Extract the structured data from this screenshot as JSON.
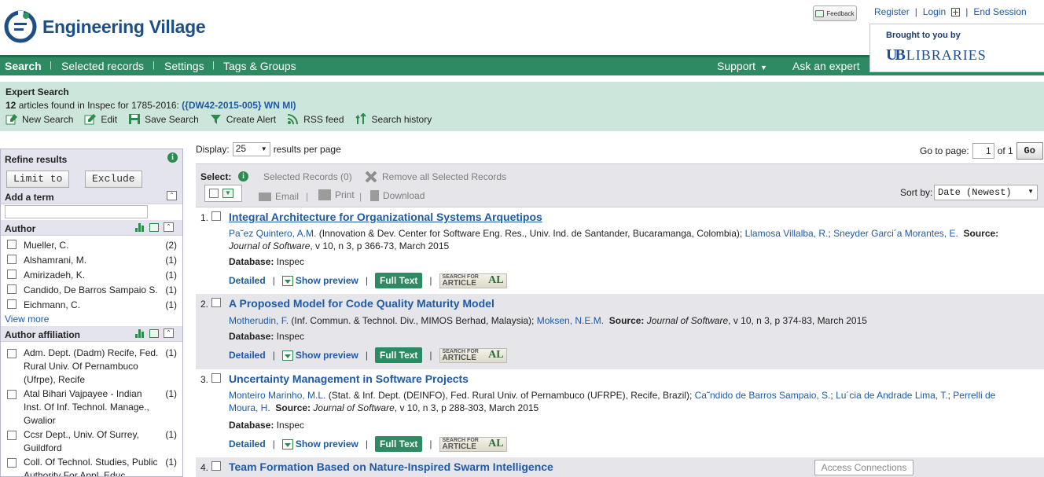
{
  "header": {
    "logo_text": "Engineering Village",
    "feedback_label": "Feedback",
    "links": [
      "Register",
      "Login",
      "End Session"
    ],
    "brought_label": "Brought to you by",
    "library_mark": "UB",
    "library_name": "LIBRARIES"
  },
  "nav": {
    "items": [
      "Search",
      "Selected records",
      "Settings",
      "Tags & Groups"
    ],
    "support": "Support",
    "ask": "Ask an expert"
  },
  "search": {
    "title": "Expert Search",
    "count": "12",
    "summary_text": " articles found in Inspec for 1785-2016: ",
    "query": "({DW42-2015-005} WN MI)",
    "actions": [
      "New Search",
      "Edit",
      "Save Search",
      "Create Alert",
      "RSS feed",
      "Search history"
    ]
  },
  "sidebar": {
    "refine_title": "Refine results",
    "limit_label": "Limit to",
    "exclude_label": "Exclude",
    "add_term": "Add a term",
    "author_title": "Author",
    "authors": [
      {
        "name": "Mueller, C.",
        "count": "(2)"
      },
      {
        "name": "Alshamrani, M.",
        "count": "(1)"
      },
      {
        "name": "Amirizadeh, K.",
        "count": "(1)"
      },
      {
        "name": "Candido, De Barros Sampaio S.",
        "count": "(1)"
      },
      {
        "name": "Eichmann, C.",
        "count": "(1)"
      }
    ],
    "view_more": "View more",
    "affiliation_title": "Author affiliation",
    "affiliations": [
      {
        "name": "Adm. Dept. (Dadm) Recife, Fed. Rural Univ. Of Pernambuco (Ufrpe), Recife",
        "count": "(1)"
      },
      {
        "name": "Atal Bihari Vajpayee - Indian Inst. Of Inf. Technol. Manage., Gwalior",
        "count": "(1)"
      },
      {
        "name": "Ccsr Dept., Univ. Of Surrey, Guildford",
        "count": "(1)"
      },
      {
        "name": "Coll. Of Technol. Studies, Public Authority For Appl. Educ.",
        "count": "(1)"
      }
    ]
  },
  "results_bar": {
    "display_label": "Display:",
    "per_page": "25",
    "per_page_suffix": "results per page",
    "goto_label": "Go to page:",
    "page_value": "1",
    "of_label": "of 1",
    "go_label": "Go"
  },
  "toolbar": {
    "select_label": "Select:",
    "selected_records": "Selected Records (0)",
    "remove_all": "Remove all Selected Records",
    "email": "Email",
    "print": "Print",
    "download": "Download",
    "sort_label": "Sort by:",
    "sort_value": "Date (Newest)"
  },
  "result_common": {
    "database_label": "Database:",
    "database_value": "Inspec",
    "detailed": "Detailed",
    "show_preview": "Show preview",
    "full_text": "Full Text",
    "sfa_top": "SEARCH FOR",
    "sfa_bottom": "ARTICLE",
    "sfa_mark": "AL",
    "source_label": "Source:"
  },
  "results": [
    {
      "num": "1.",
      "title": "Integral Architecture for Organizational Systems Arquetipos",
      "a1": "Pa˜ez Quintero, A.M.",
      "a1_aff": " (Innovation & Dev. Center for Software Eng. Res., Univ. Ind. de Santander, Bucaramanga, Colombia); ",
      "a2": "Llamosa Villalba, R.",
      "a3": "Sneyder Garci´a Morantes, E.",
      "journal": "Journal of Software",
      "cite": ", v 10, n 3, p 366-73, March 2015"
    },
    {
      "num": "2.",
      "title": "A Proposed Model for Code Quality Maturity Model",
      "a1": "Motherudin, F.",
      "a1_aff": " (Inf. Commun. & Technol. Div., MIMOS Berhad, Malaysia); ",
      "a2": "Moksen, N.E.M.",
      "journal": "Journal of Software",
      "cite": ", v 10, n 3, p 374-83, March 2015"
    },
    {
      "num": "3.",
      "title": "Uncertainty Management in Software Projects",
      "a1": "Monteiro Marinho, M.L.",
      "a1_aff": " (Stat. & Inf. Dept. (DEINFO), Fed. Rural Univ. of Pernambuco (UFRPE), Recife, Brazil); ",
      "a2": "Ca˜ndido de Barros Sampaio, S.",
      "a3": "Lu´cia de Andrade Lima, T.",
      "a4": "Perrelli de Moura, H.",
      "journal": "Journal of Software",
      "cite": ", v 10, n 3, p 288-303, March 2015"
    },
    {
      "num": "4.",
      "title": "Team Formation Based on Nature-Inspired Swarm Intelligence"
    }
  ],
  "tooltip": "Access Connections"
}
